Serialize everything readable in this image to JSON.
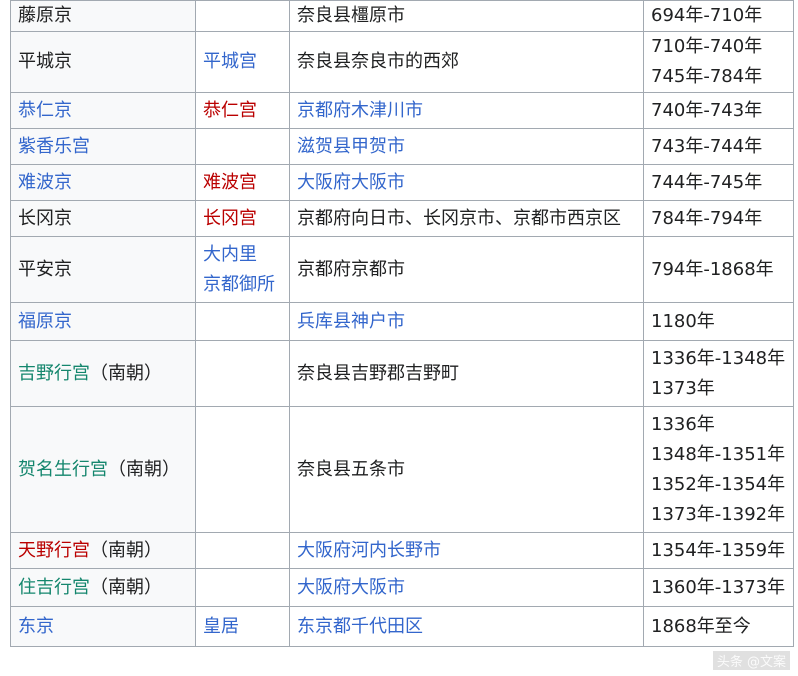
{
  "rows": [
    {
      "capital": {
        "text": "藤原京",
        "color": "dark"
      },
      "palace": [],
      "location": {
        "text": "奈良县橿原市",
        "color": "dark"
      },
      "period": [
        "694年-710年"
      ]
    },
    {
      "capital": {
        "text": "平城京",
        "color": "dark"
      },
      "palace": [
        {
          "text": "平城宫",
          "color": "blue"
        }
      ],
      "location": {
        "text": "奈良县奈良市的西郊",
        "color": "dark"
      },
      "period": [
        "710年-740年",
        "745年-784年"
      ]
    },
    {
      "capital": {
        "text": "恭仁京",
        "color": "blue"
      },
      "palace": [
        {
          "text": "恭仁宫",
          "color": "red"
        }
      ],
      "location": {
        "text": "京都府木津川市",
        "color": "blue"
      },
      "period": [
        "740年-743年"
      ]
    },
    {
      "capital": {
        "text": "紫香乐宫",
        "color": "blue"
      },
      "palace": [],
      "location": {
        "text": "滋贺县甲贺市",
        "color": "blue"
      },
      "period": [
        "743年-744年"
      ]
    },
    {
      "capital": {
        "text": "难波京",
        "color": "blue"
      },
      "palace": [
        {
          "text": "难波宫",
          "color": "red"
        }
      ],
      "location": {
        "text": "大阪府大阪市",
        "color": "blue"
      },
      "period": [
        "744年-745年"
      ]
    },
    {
      "capital": {
        "text": "长冈京",
        "color": "dark"
      },
      "palace": [
        {
          "text": "长冈宫",
          "color": "red"
        }
      ],
      "location": {
        "text": "京都府向日市、长冈京市、京都市西京区",
        "color": "dark"
      },
      "period": [
        "784年-794年"
      ]
    },
    {
      "capital": {
        "text": "平安京",
        "color": "dark"
      },
      "palace": [
        {
          "text": "大内里",
          "color": "blue"
        },
        {
          "text": "京都御所",
          "color": "blue"
        }
      ],
      "location": {
        "text": "京都府京都市",
        "color": "dark"
      },
      "period": [
        "794年-1868年"
      ]
    },
    {
      "capital": {
        "text": "福原京",
        "color": "blue"
      },
      "palace": [],
      "location": {
        "text": "兵库县神户市",
        "color": "blue"
      },
      "period": [
        "1180年"
      ]
    },
    {
      "capital": {
        "text": "吉野行宫",
        "color": "green",
        "suffix": "（南朝）"
      },
      "palace": [],
      "location": {
        "text": "奈良县吉野郡吉野町",
        "color": "dark"
      },
      "period": [
        "1336年-1348年",
        "1373年"
      ]
    },
    {
      "capital": {
        "text": "贺名生行宫",
        "color": "green",
        "suffix": "（南朝）"
      },
      "palace": [],
      "location": {
        "text": "奈良县五条市",
        "color": "dark"
      },
      "period": [
        "1336年",
        "1348年-1351年",
        "1352年-1354年",
        "1373年-1392年"
      ]
    },
    {
      "capital": {
        "text": "天野行宫",
        "color": "red",
        "suffix": "（南朝）"
      },
      "palace": [],
      "location": {
        "text": "大阪府河内长野市",
        "color": "blue"
      },
      "period": [
        "1354年-1359年"
      ]
    },
    {
      "capital": {
        "text": "住吉行宫",
        "color": "green",
        "suffix": "（南朝）"
      },
      "palace": [],
      "location": {
        "text": "大阪府大阪市",
        "color": "blue"
      },
      "period": [
        "1360年-1373年"
      ]
    },
    {
      "capital": {
        "text": "东京",
        "color": "blue"
      },
      "palace": [
        {
          "text": "皇居",
          "color": "blue"
        }
      ],
      "location": {
        "text": "东京都千代田区",
        "color": "blue"
      },
      "period": [
        "1868年至今"
      ]
    }
  ],
  "colors": {
    "link": "#3366cc",
    "redlink": "#ba0000",
    "green": "#14866d",
    "text": "#202122",
    "border": "#a2a9b1"
  },
  "watermark": "头条 @文案"
}
